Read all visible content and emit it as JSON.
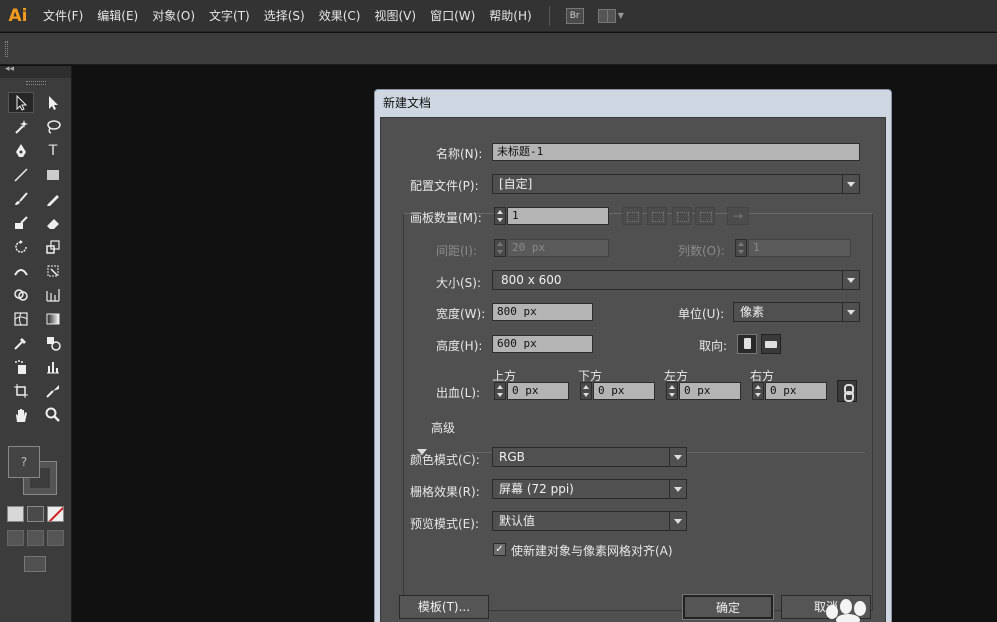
{
  "menubar": {
    "logo": "Ai",
    "items": [
      "文件(F)",
      "编辑(E)",
      "对象(O)",
      "文字(T)",
      "选择(S)",
      "效果(C)",
      "视图(V)",
      "窗口(W)",
      "帮助(H)"
    ],
    "bridge_label": "Br"
  },
  "toolpanel": {
    "collapse_glyph": "◂◂",
    "tool_glyphs": {
      "type": "T"
    },
    "fill_glyph": "?"
  },
  "dialog": {
    "title": "新建文档",
    "name_label": "名称(N):",
    "name_value": "未标题-1",
    "profile_label": "配置文件(P):",
    "profile_value": "[自定]",
    "artboards_label": "画板数量(M):",
    "artboards_value": "1",
    "spacing_label": "间距(I):",
    "spacing_value": "20 px",
    "columns_label": "列数(O):",
    "columns_value": "1",
    "size_label": "大小(S):",
    "size_value": "800 x 600",
    "width_label": "宽度(W):",
    "width_value": "800 px",
    "units_label": "单位(U):",
    "units_value": "像素",
    "height_label": "高度(H):",
    "height_value": "600 px",
    "orientation_label": "取向:",
    "bleed_label": "出血(L):",
    "bleed": {
      "top_label": "上方",
      "top_value": "0 px",
      "bottom_label": "下方",
      "bottom_value": "0 px",
      "left_label": "左方",
      "left_value": "0 px",
      "right_label": "右方",
      "right_value": "0 px"
    },
    "advanced_label": "高级",
    "color_mode_label": "颜色模式(C):",
    "color_mode_value": "RGB",
    "raster_label": "栅格效果(R):",
    "raster_value": "屏幕 (72 ppi)",
    "preview_label": "预览模式(E):",
    "preview_value": "默认值",
    "align_pixel_label": "使新建对象与像素网格对齐(A)",
    "align_pixel_checked": true,
    "align_checkmark": "✓",
    "arrow_right": "→",
    "templates_button": "模板(T)...",
    "ok_button": "确定",
    "cancel_button": "取消"
  },
  "colors": {
    "menubar_bg": "#333333",
    "panel_bg": "#3c3c3c",
    "canvas_bg": "#111111",
    "dialog_body": "#505050",
    "logo": "#f29b20"
  }
}
